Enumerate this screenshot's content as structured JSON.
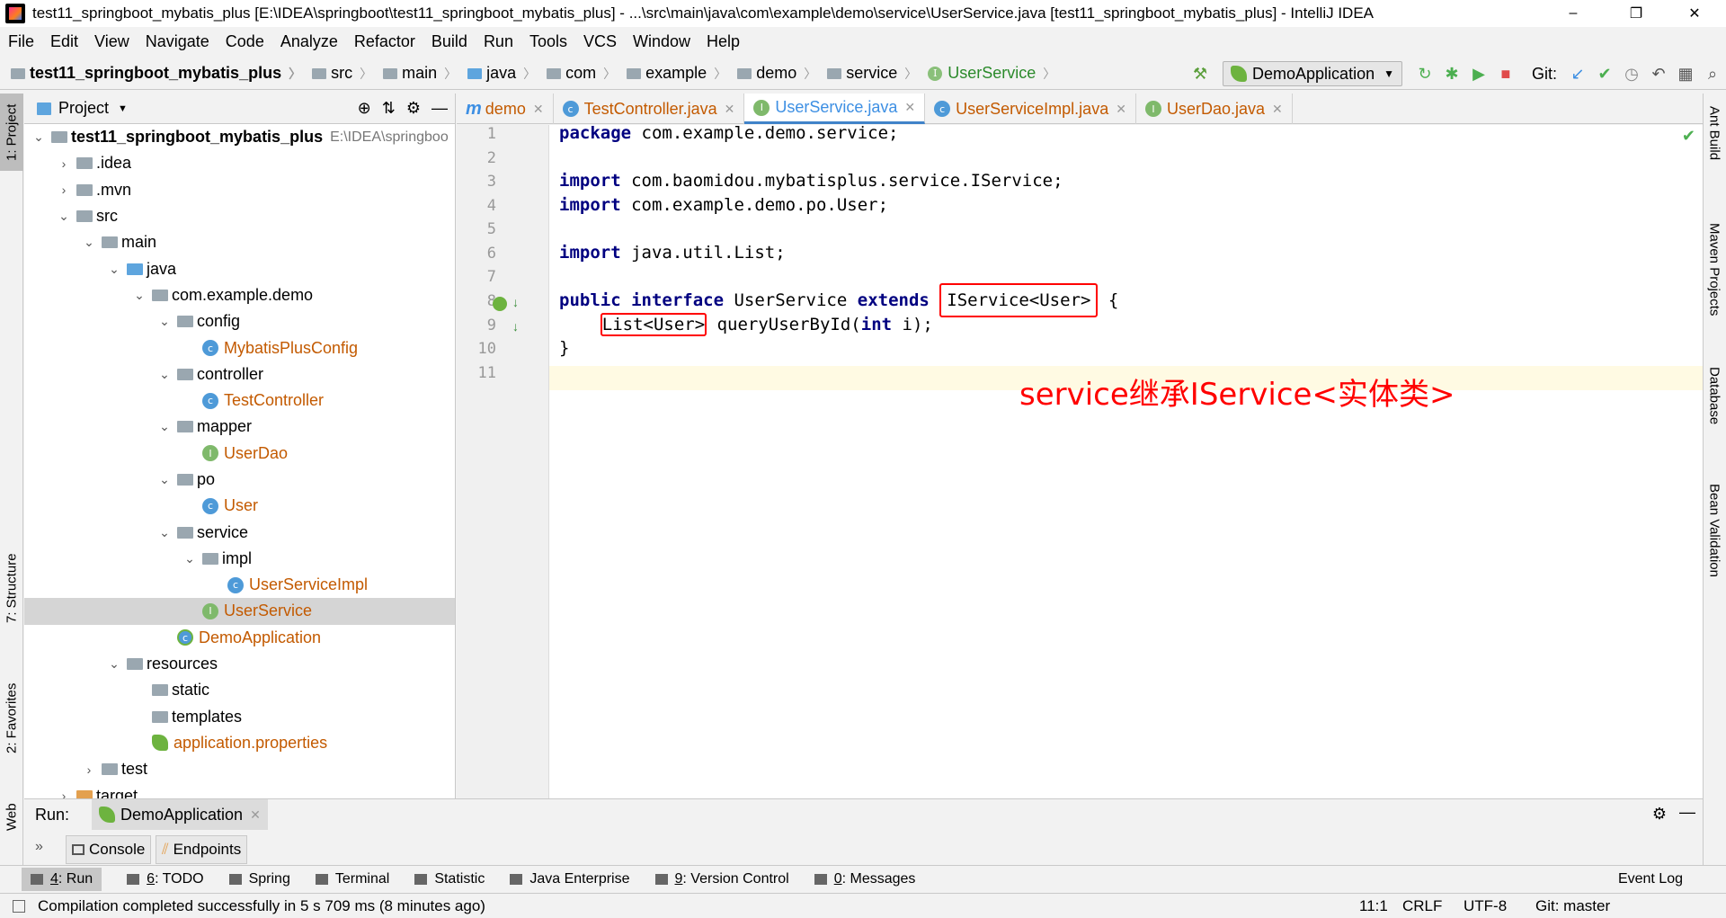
{
  "window": {
    "title": "test11_springboot_mybatis_plus [E:\\IDEA\\springboot\\test11_springboot_mybatis_plus] - ...\\src\\main\\java\\com\\example\\demo\\service\\UserService.java [test11_springboot_mybatis_plus] - IntelliJ IDEA",
    "minimize": "–",
    "restore": "❐",
    "close": "✕"
  },
  "menu": [
    "File",
    "Edit",
    "View",
    "Navigate",
    "Code",
    "Analyze",
    "Refactor",
    "Build",
    "Run",
    "Tools",
    "VCS",
    "Window",
    "Help"
  ],
  "breadcrumbs": [
    "test11_springboot_mybatis_plus",
    "src",
    "main",
    "java",
    "com",
    "example",
    "demo",
    "service",
    "UserService"
  ],
  "toolbar": {
    "run_config": "DemoApplication",
    "git_label": "Git:"
  },
  "left_tabs": {
    "project": "1: Project",
    "structure": "7: Structure",
    "favorites": "2: Favorites",
    "web": "Web"
  },
  "right_tabs": {
    "ant": "Ant Build",
    "maven": "Maven Projects",
    "database": "Database",
    "bean": "Bean Validation"
  },
  "project_panel": {
    "title": "Project",
    "tree": [
      {
        "label": "test11_springboot_mybatis_plus",
        "hint": "E:\\IDEA\\springboo",
        "depth": 0,
        "arrow": "⌄",
        "icon": "folder",
        "bold": true
      },
      {
        "label": ".idea",
        "depth": 1,
        "arrow": "›",
        "icon": "folder"
      },
      {
        "label": ".mvn",
        "depth": 1,
        "arrow": "›",
        "icon": "folder"
      },
      {
        "label": "src",
        "depth": 1,
        "arrow": "⌄",
        "icon": "folder"
      },
      {
        "label": "main",
        "depth": 2,
        "arrow": "⌄",
        "icon": "folder"
      },
      {
        "label": "java",
        "depth": 3,
        "arrow": "⌄",
        "icon": "folder-blue"
      },
      {
        "label": "com.example.demo",
        "depth": 4,
        "arrow": "⌄",
        "icon": "package"
      },
      {
        "label": "config",
        "depth": 5,
        "arrow": "⌄",
        "icon": "package"
      },
      {
        "label": "MybatisPlusConfig",
        "depth": 6,
        "arrow": "",
        "icon": "class",
        "orange": true
      },
      {
        "label": "controller",
        "depth": 5,
        "arrow": "⌄",
        "icon": "package"
      },
      {
        "label": "TestController",
        "depth": 6,
        "arrow": "",
        "icon": "class",
        "orange": true
      },
      {
        "label": "mapper",
        "depth": 5,
        "arrow": "⌄",
        "icon": "package"
      },
      {
        "label": "UserDao",
        "depth": 6,
        "arrow": "",
        "icon": "interface",
        "orange": true
      },
      {
        "label": "po",
        "depth": 5,
        "arrow": "⌄",
        "icon": "package"
      },
      {
        "label": "User",
        "depth": 6,
        "arrow": "",
        "icon": "class",
        "orange": true
      },
      {
        "label": "service",
        "depth": 5,
        "arrow": "⌄",
        "icon": "package"
      },
      {
        "label": "impl",
        "depth": 6,
        "arrow": "⌄",
        "icon": "package"
      },
      {
        "label": "UserServiceImpl",
        "depth": 7,
        "arrow": "",
        "icon": "class",
        "orange": true
      },
      {
        "label": "UserService",
        "depth": 6,
        "arrow": "",
        "icon": "interface",
        "orange": true,
        "selected": true
      },
      {
        "label": "DemoApplication",
        "depth": 5,
        "arrow": "",
        "icon": "app",
        "orange": true
      },
      {
        "label": "resources",
        "depth": 3,
        "arrow": "⌄",
        "icon": "folder"
      },
      {
        "label": "static",
        "depth": 4,
        "arrow": "",
        "icon": "folder"
      },
      {
        "label": "templates",
        "depth": 4,
        "arrow": "",
        "icon": "folder"
      },
      {
        "label": "application.properties",
        "depth": 4,
        "arrow": "",
        "icon": "spring",
        "orange": true
      },
      {
        "label": "test",
        "depth": 2,
        "arrow": "›",
        "icon": "folder"
      },
      {
        "label": "target",
        "depth": 1,
        "arrow": "›",
        "icon": "folder-orange"
      }
    ]
  },
  "editor_tabs": [
    {
      "label": "demo",
      "icon": "m",
      "active": false
    },
    {
      "label": "TestController.java",
      "icon": "C",
      "active": false
    },
    {
      "label": "UserService.java",
      "icon": "I",
      "active": true
    },
    {
      "label": "UserServiceImpl.java",
      "icon": "C",
      "active": false
    },
    {
      "label": "UserDao.java",
      "icon": "I",
      "active": false
    }
  ],
  "code": {
    "lines": [
      "1",
      "2",
      "3",
      "4",
      "5",
      "6",
      "7",
      "8",
      "9",
      "10",
      "11"
    ],
    "l1_kw": "package",
    "l1_rest": " com.example.demo.service;",
    "l3_kw": "import",
    "l3_rest": " com.baomidou.mybatisplus.service.IService;",
    "l4_kw": "import",
    "l4_rest": " com.example.demo.po.User;",
    "l6_kw": "import",
    "l6_rest": " java.util.List;",
    "l8_kw1": "public",
    "l8_kw2": "interface",
    "l8_name": " UserService ",
    "l8_kw3": "extends",
    "l8_boxed": "IService<User>",
    "l8_end": " {",
    "l9_indent": "    ",
    "l9_boxed": "List<User>",
    "l9_mid": " queryUserById(",
    "l9_kw": "int",
    "l9_end": " i);",
    "l10": "}"
  },
  "annotation": "service继承IService<实体类>",
  "run_panel": {
    "label": "Run:",
    "config": "DemoApplication",
    "console": "Console",
    "endpoints": "Endpoints"
  },
  "tool_windows": [
    {
      "key": "4",
      "label": ": Run",
      "icon": "run-icon"
    },
    {
      "key": "6",
      "label": ": TODO",
      "icon": "todo-icon"
    },
    {
      "key": "",
      "label": "Spring",
      "icon": "spring-icon"
    },
    {
      "key": "",
      "label": "Terminal",
      "icon": "terminal-icon"
    },
    {
      "key": "",
      "label": "Statistic",
      "icon": "statistic-icon"
    },
    {
      "key": "",
      "label": "Java Enterprise",
      "icon": "java-enterprise-icon"
    },
    {
      "key": "9",
      "label": ": Version Control",
      "icon": "vcs-icon"
    },
    {
      "key": "0",
      "label": ": Messages",
      "icon": "messages-icon"
    }
  ],
  "event_log": "Event Log",
  "status": {
    "message": "Compilation completed successfully in 5 s 709 ms (8 minutes ago)",
    "position": "11:1",
    "line_sep": "CRLF",
    "encoding": "UTF-8",
    "git": "Git: master"
  },
  "colors": {
    "keyword": "#000080",
    "annotation": "#ff0000",
    "accent": "#4083c9",
    "spring": "#6db33f"
  }
}
